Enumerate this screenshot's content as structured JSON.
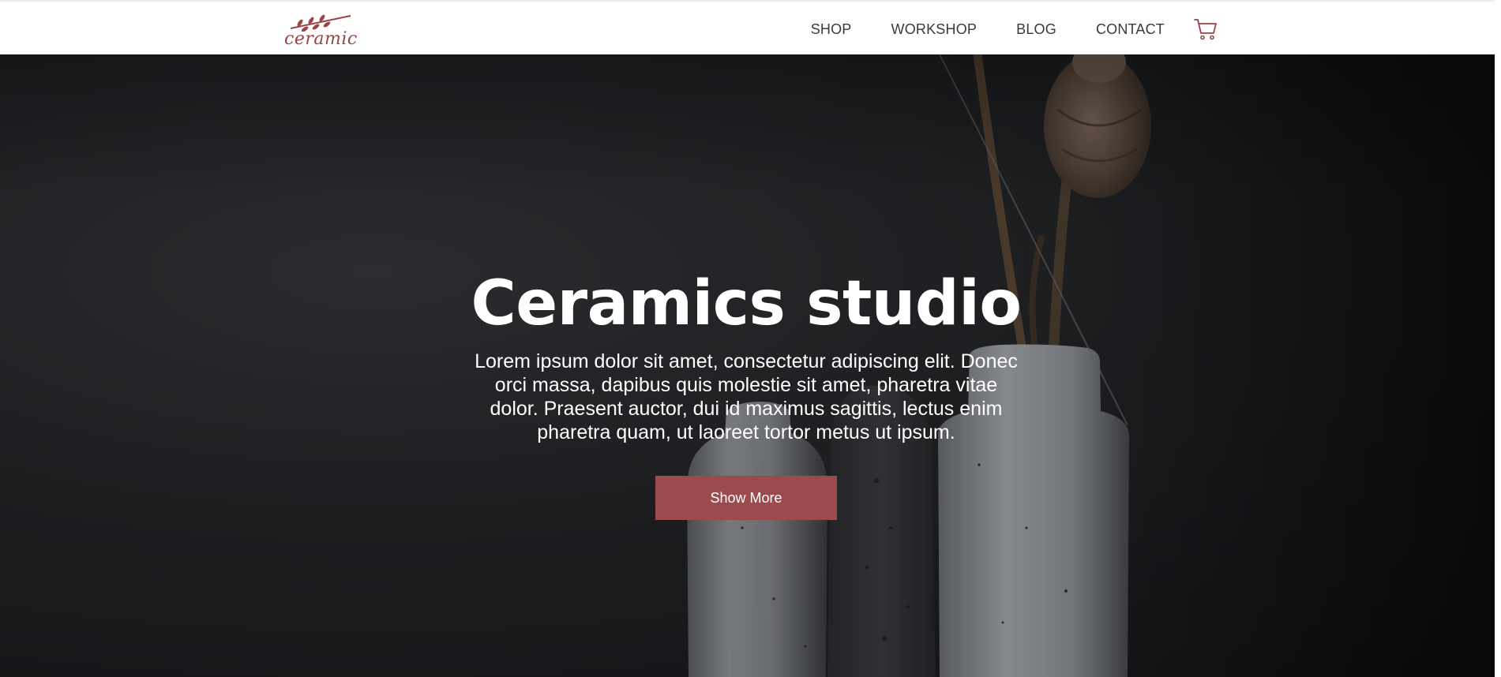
{
  "brand": {
    "logo_text": "ceramic",
    "logo_color": "#9b4448"
  },
  "nav": {
    "items": [
      {
        "label": "SHOP"
      },
      {
        "label": "WORKSHOP"
      },
      {
        "label": "BLOG"
      },
      {
        "label": "CONTACT"
      }
    ],
    "cart_icon": "cart-icon"
  },
  "hero": {
    "title": "Ceramics studio",
    "text": "Lorem ipsum dolor sit amet, consectetur adipiscing elit. Donec orci massa, dapibus quis molestie sit amet, pharetra vitae dolor. Praesent auctor, dui id maximus sagittis, lectus enim pharetra quam, ut laoreet tortor metus ut ipsum.",
    "button_label": "Show More",
    "button_color": "#9b4b4d"
  },
  "colors": {
    "accent": "#9b4b4d",
    "hero_background": "#1f2023",
    "nav_text": "#3a3a3a"
  }
}
